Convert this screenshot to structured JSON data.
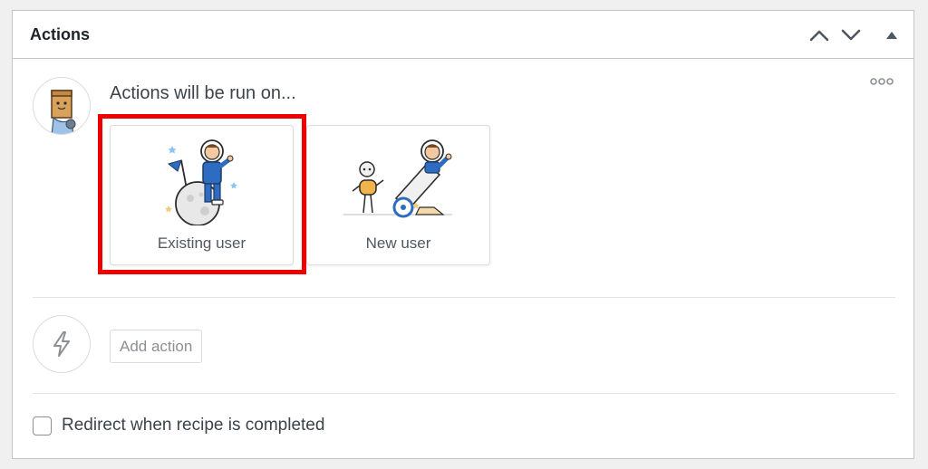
{
  "panel": {
    "title": "Actions",
    "controls": [
      "chevron-up-icon",
      "chevron-down-icon",
      "triangle-up-icon"
    ]
  },
  "run_on": {
    "heading": "Actions will be run on...",
    "options": [
      {
        "label": "Existing user",
        "icon": "astronaut-on-moon-icon",
        "highlighted": true
      },
      {
        "label": "New user",
        "icon": "astronaut-cannon-robot-icon",
        "highlighted": false
      }
    ],
    "highlight_color": "#ee0000"
  },
  "add_action": {
    "label": "Add action",
    "icon": "bolt-icon"
  },
  "redirect": {
    "label": "Redirect when recipe is completed",
    "checked": false
  }
}
